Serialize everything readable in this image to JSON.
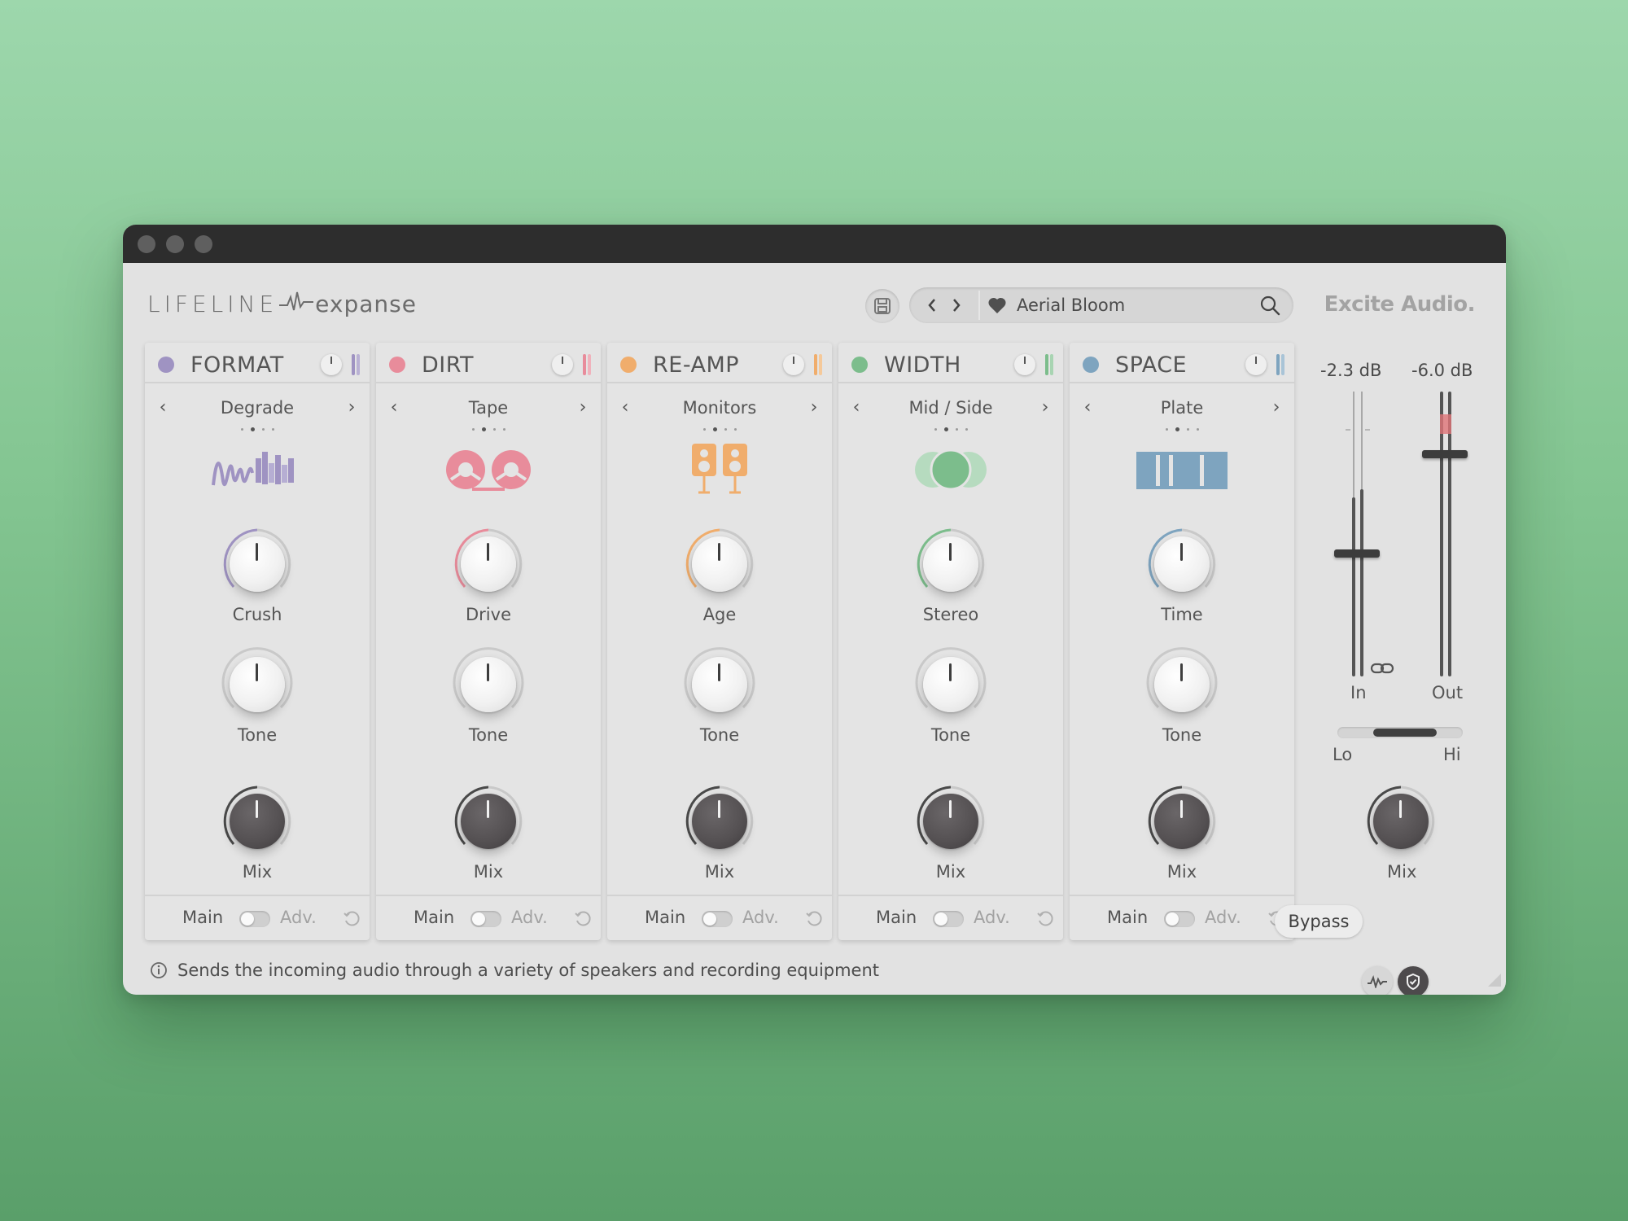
{
  "header": {
    "logo_main": "LIFELINE",
    "logo_sub": "expanse",
    "preset_name": "Aerial Bloom",
    "brand": "Excite Audio."
  },
  "modules": [
    {
      "title": "FORMAT",
      "accent": "#9f93c2",
      "selection": "Degrade",
      "knob1": "Crush",
      "knob2": "Tone",
      "knob3": "Mix",
      "foot_main": "Main",
      "foot_adv": "Adv."
    },
    {
      "title": "DIRT",
      "accent": "#e88c9b",
      "selection": "Tape",
      "knob1": "Drive",
      "knob2": "Tone",
      "knob3": "Mix",
      "foot_main": "Main",
      "foot_adv": "Adv."
    },
    {
      "title": "RE-AMP",
      "accent": "#f0ad6c",
      "selection": "Monitors",
      "knob1": "Age",
      "knob2": "Tone",
      "knob3": "Mix",
      "foot_main": "Main",
      "foot_adv": "Adv."
    },
    {
      "title": "WIDTH",
      "accent": "#7cbd8c",
      "selection": "Mid / Side",
      "knob1": "Stereo",
      "knob2": "Tone",
      "knob3": "Mix",
      "foot_main": "Main",
      "foot_adv": "Adv."
    },
    {
      "title": "SPACE",
      "accent": "#7ea4bf",
      "selection": "Plate",
      "knob1": "Time",
      "knob2": "Tone",
      "knob3": "Mix",
      "foot_main": "Main",
      "foot_adv": "Adv."
    }
  ],
  "master": {
    "in_db": "-2.3 dB",
    "out_db": "-6.0 dB",
    "in_label": "In",
    "out_label": "Out",
    "lo_label": "Lo",
    "hi_label": "Hi",
    "mix_label": "Mix",
    "bypass_label": "Bypass"
  },
  "info_text": "Sends the incoming audio through a variety of speakers and recording equipment"
}
